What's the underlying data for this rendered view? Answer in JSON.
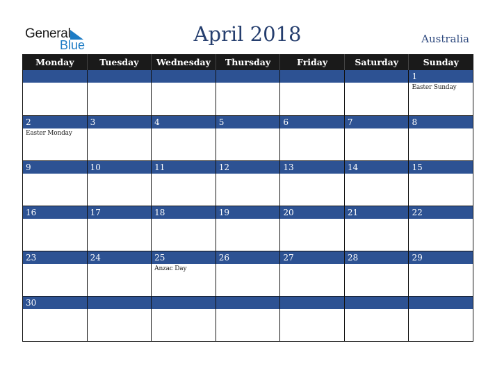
{
  "logo": {
    "word1": "General",
    "word2": "Blue"
  },
  "title": "April 2018",
  "country": "Australia",
  "colors": {
    "header_bg": "#1a1a1a",
    "day_bar": "#2d5293",
    "title": "#253e6e",
    "logo_blue": "#1d7cc5"
  },
  "weekdays": [
    "Monday",
    "Tuesday",
    "Wednesday",
    "Thursday",
    "Friday",
    "Saturday",
    "Sunday"
  ],
  "weeks": [
    [
      {
        "day": "",
        "event": ""
      },
      {
        "day": "",
        "event": ""
      },
      {
        "day": "",
        "event": ""
      },
      {
        "day": "",
        "event": ""
      },
      {
        "day": "",
        "event": ""
      },
      {
        "day": "",
        "event": ""
      },
      {
        "day": "1",
        "event": "Easter Sunday"
      }
    ],
    [
      {
        "day": "2",
        "event": "Easter Monday"
      },
      {
        "day": "3",
        "event": ""
      },
      {
        "day": "4",
        "event": ""
      },
      {
        "day": "5",
        "event": ""
      },
      {
        "day": "6",
        "event": ""
      },
      {
        "day": "7",
        "event": ""
      },
      {
        "day": "8",
        "event": ""
      }
    ],
    [
      {
        "day": "9",
        "event": ""
      },
      {
        "day": "10",
        "event": ""
      },
      {
        "day": "11",
        "event": ""
      },
      {
        "day": "12",
        "event": ""
      },
      {
        "day": "13",
        "event": ""
      },
      {
        "day": "14",
        "event": ""
      },
      {
        "day": "15",
        "event": ""
      }
    ],
    [
      {
        "day": "16",
        "event": ""
      },
      {
        "day": "17",
        "event": ""
      },
      {
        "day": "18",
        "event": ""
      },
      {
        "day": "19",
        "event": ""
      },
      {
        "day": "20",
        "event": ""
      },
      {
        "day": "21",
        "event": ""
      },
      {
        "day": "22",
        "event": ""
      }
    ],
    [
      {
        "day": "23",
        "event": ""
      },
      {
        "day": "24",
        "event": ""
      },
      {
        "day": "25",
        "event": "Anzac Day"
      },
      {
        "day": "26",
        "event": ""
      },
      {
        "day": "27",
        "event": ""
      },
      {
        "day": "28",
        "event": ""
      },
      {
        "day": "29",
        "event": ""
      }
    ],
    [
      {
        "day": "30",
        "event": ""
      },
      {
        "day": "",
        "event": ""
      },
      {
        "day": "",
        "event": ""
      },
      {
        "day": "",
        "event": ""
      },
      {
        "day": "",
        "event": ""
      },
      {
        "day": "",
        "event": ""
      },
      {
        "day": "",
        "event": ""
      }
    ]
  ]
}
